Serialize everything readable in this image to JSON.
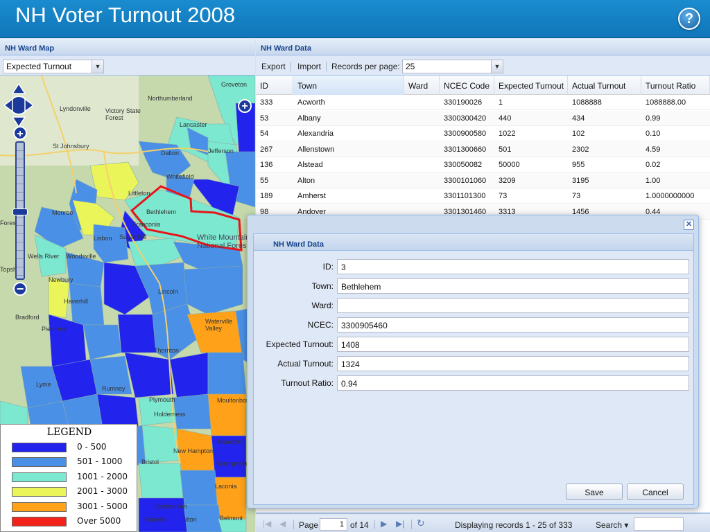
{
  "app": {
    "title": "NH Voter Turnout 2008",
    "help_label": "?"
  },
  "map_panel": {
    "title": "NH Ward Map",
    "layer_select": "Expected Turnout",
    "labels": [
      "Northumberland",
      "Lyndonville",
      "Victory State Forest",
      "Lancaster",
      "St Johnsbury",
      "Dalton",
      "Jefferson",
      "Littleton",
      "Whitefield",
      "Bethlehem",
      "Franconia",
      "Monroe",
      "Sugar Hill",
      "Lisbon",
      "White Mountain National Forest",
      "Wells River",
      "Woodsville",
      "Newbury",
      "Haverhill",
      "Bradford",
      "Piermont",
      "Lincoln",
      "Waterville Valley",
      "Thornton",
      "Lyme",
      "Rumney",
      "Plymouth",
      "Holderness",
      "Moultonborough",
      "Meredith",
      "New Hampton",
      "Bristol",
      "Winnipesaukee",
      "Sanbornton",
      "Laconia",
      "Franklin",
      "Tilton",
      "Belmont",
      "Groveton",
      "Forest",
      "Topsham"
    ],
    "zoom_in": "+",
    "zoom_out": "−",
    "legend": {
      "title": "LEGEND",
      "items": [
        {
          "label": "0 - 500",
          "color": "#2323ee"
        },
        {
          "label": "501 - 1000",
          "color": "#4a90e6"
        },
        {
          "label": "1001 - 2000",
          "color": "#7be8cf"
        },
        {
          "label": "2001 - 3000",
          "color": "#eaf55a"
        },
        {
          "label": "3001 - 5000",
          "color": "#ffa21a"
        },
        {
          "label": "Over 5000",
          "color": "#f2231a"
        }
      ]
    }
  },
  "grid_panel": {
    "title": "NH Ward Data",
    "toolbar": {
      "export": "Export",
      "import": "Import",
      "rpp_label": "Records per page:",
      "rpp_value": "25"
    },
    "columns": [
      "ID",
      "Town",
      "Ward",
      "NCEC Code",
      "Expected Turnout",
      "Actual Turnout",
      "Turnout Ratio"
    ],
    "rows": [
      {
        "id": "333",
        "town": "Acworth",
        "ward": "",
        "ncec": "330190026",
        "expected": "1",
        "actual": "1088888",
        "ratio": "1088888.00"
      },
      {
        "id": "53",
        "town": "Albany",
        "ward": "",
        "ncec": "3300300420",
        "expected": "440",
        "actual": "434",
        "ratio": "0.99"
      },
      {
        "id": "54",
        "town": "Alexandria",
        "ward": "",
        "ncec": "3300900580",
        "expected": "1022",
        "actual": "102",
        "ratio": "0.10"
      },
      {
        "id": "267",
        "town": "Allenstown",
        "ward": "",
        "ncec": "3301300660",
        "expected": "501",
        "actual": "2302",
        "ratio": "4.59"
      },
      {
        "id": "136",
        "town": "Alstead",
        "ward": "",
        "ncec": "330050082",
        "expected": "50000",
        "actual": "955",
        "ratio": "0.02"
      },
      {
        "id": "55",
        "town": "Alton",
        "ward": "",
        "ncec": "3300101060",
        "expected": "3209",
        "actual": "3195",
        "ratio": "1.00"
      },
      {
        "id": "189",
        "town": "Amherst",
        "ward": "",
        "ncec": "3301101300",
        "expected": "73",
        "actual": "73",
        "ratio": "1.0000000000"
      },
      {
        "id": "98",
        "town": "Andover",
        "ward": "",
        "ncec": "3301301460",
        "expected": "3313",
        "actual": "1456",
        "ratio": "0.44"
      }
    ],
    "paging": {
      "page_label": "Page",
      "page_value": "1",
      "of_label": "of 14",
      "display": "Displaying records 1 - 25 of 333",
      "search_label": "Search ▾"
    }
  },
  "dialog": {
    "title": "NH Ward Data",
    "close": "✕",
    "fields": [
      {
        "label": "ID:",
        "value": "3"
      },
      {
        "label": "Town:",
        "value": "Bethlehem"
      },
      {
        "label": "Ward:",
        "value": ""
      },
      {
        "label": "NCEC:",
        "value": "3300905460"
      },
      {
        "label": "Expected Turnout:",
        "value": "1408"
      },
      {
        "label": "Actual Turnout:",
        "value": "1324"
      },
      {
        "label": "Turnout Ratio:",
        "value": "0.94"
      }
    ],
    "save": "Save",
    "cancel": "Cancel"
  }
}
